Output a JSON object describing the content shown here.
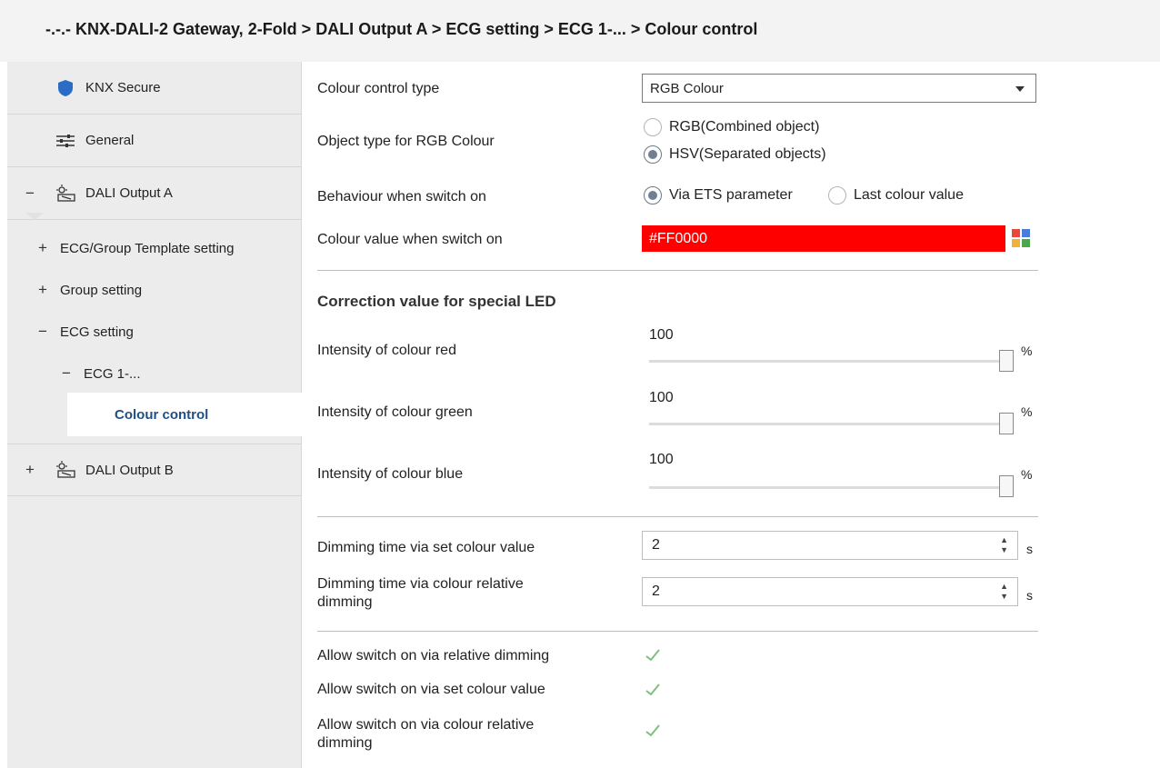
{
  "breadcrumb": "-.-.- KNX-DALI-2 Gateway, 2-Fold > DALI Output A > ECG setting > ECG 1-... > Colour control",
  "sidebar": {
    "items": [
      {
        "label": "KNX Secure"
      },
      {
        "label": "General"
      },
      {
        "label": "DALI Output A",
        "toggle": "−"
      },
      {
        "label": "ECG/Group Template setting",
        "toggle": "+"
      },
      {
        "label": "Group setting",
        "toggle": "+"
      },
      {
        "label": "ECG setting",
        "toggle": "−"
      },
      {
        "label": "ECG 1-...",
        "toggle": "−"
      },
      {
        "label": "Colour control"
      },
      {
        "label": "DALI Output B",
        "toggle": "+"
      }
    ]
  },
  "params": {
    "colour_control_type": {
      "label": "Colour control type",
      "value": "RGB Colour"
    },
    "object_type": {
      "label": "Object type for RGB Colour",
      "option_1": "RGB(Combined object)",
      "option_2": "HSV(Separated objects)",
      "selected": 2
    },
    "behaviour": {
      "label": "Behaviour when switch on",
      "option_1": "Via ETS parameter",
      "option_2": "Last colour value",
      "selected": 1
    },
    "colour_value": {
      "label": "Colour value when switch on",
      "value": "#FF0000",
      "color": "#ff0000"
    },
    "correction_title": "Correction value for special LED",
    "intensity_red": {
      "label": "Intensity of colour red",
      "value": "100",
      "unit": "%",
      "fraction": 1.0
    },
    "intensity_green": {
      "label": "Intensity of colour green",
      "value": "100",
      "unit": "%",
      "fraction": 1.0
    },
    "intensity_blue": {
      "label": "Intensity of colour blue",
      "value": "100",
      "unit": "%",
      "fraction": 1.0
    },
    "dimming_set": {
      "label": "Dimming time via set colour value",
      "value": "2",
      "unit": "s"
    },
    "dimming_relative": {
      "label_1": "Dimming time via colour relative",
      "label_2": "dimming",
      "value": "2",
      "unit": "s"
    },
    "allow_relative": {
      "label": "Allow switch on via relative dimming",
      "checked": true
    },
    "allow_set": {
      "label": "Allow switch on via set colour value",
      "checked": true
    },
    "allow_colour_relative": {
      "label_1": "Allow switch on via colour relative",
      "label_2": "dimming",
      "checked": true
    }
  },
  "colors": {
    "accent": "#1f4f86",
    "shield": "#2b6cc4",
    "check": "#7fbf7f"
  }
}
